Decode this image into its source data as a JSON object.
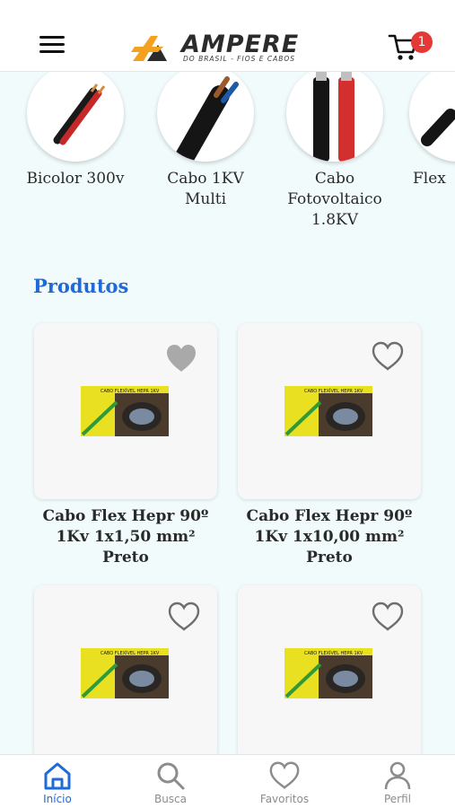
{
  "header": {
    "brand_name": "AMPERE",
    "brand_tagline": "DO BRASIL - FIOS E CABOS",
    "cart_count": "1",
    "colors": {
      "accent": "#1f6ad9",
      "badge": "#e53935",
      "logo_orange": "#f4a11f"
    }
  },
  "categories": [
    {
      "label": "Bicolor 300v",
      "icon": "red-black-wire-image"
    },
    {
      "label": "Cabo 1KV Multi",
      "icon": "black-multi-cable-image"
    },
    {
      "label": "Cabo Fotovoltaico 1.8KV",
      "icon": "solar-cable-image"
    },
    {
      "label": "Flex",
      "icon": "flex-cable-image"
    }
  ],
  "section": {
    "title": "Produtos"
  },
  "products": [
    {
      "name": "Cabo Flex Hepr 90º 1Kv 1x1,50 mm² Preto",
      "favorited": true,
      "thumb_text": "CABO FLEXÍVEL HEPR 1KV"
    },
    {
      "name": "Cabo Flex Hepr 90º 1Kv 1x10,00 mm² Preto",
      "favorited": false,
      "thumb_text": "CABO FLEXÍVEL HEPR 1KV"
    },
    {
      "name": "",
      "favorited": false,
      "thumb_text": "CABO FLEXÍVEL HEPR 1KV"
    },
    {
      "name": "",
      "favorited": false,
      "thumb_text": "CABO FLEXÍVEL HEPR 1KV"
    }
  ],
  "nav": {
    "items": [
      {
        "label": "Início",
        "icon": "home-icon",
        "active": true
      },
      {
        "label": "Busca",
        "icon": "search-icon",
        "active": false
      },
      {
        "label": "Favoritos",
        "icon": "heart-icon",
        "active": false
      },
      {
        "label": "Perfil",
        "icon": "user-icon",
        "active": false
      }
    ]
  }
}
